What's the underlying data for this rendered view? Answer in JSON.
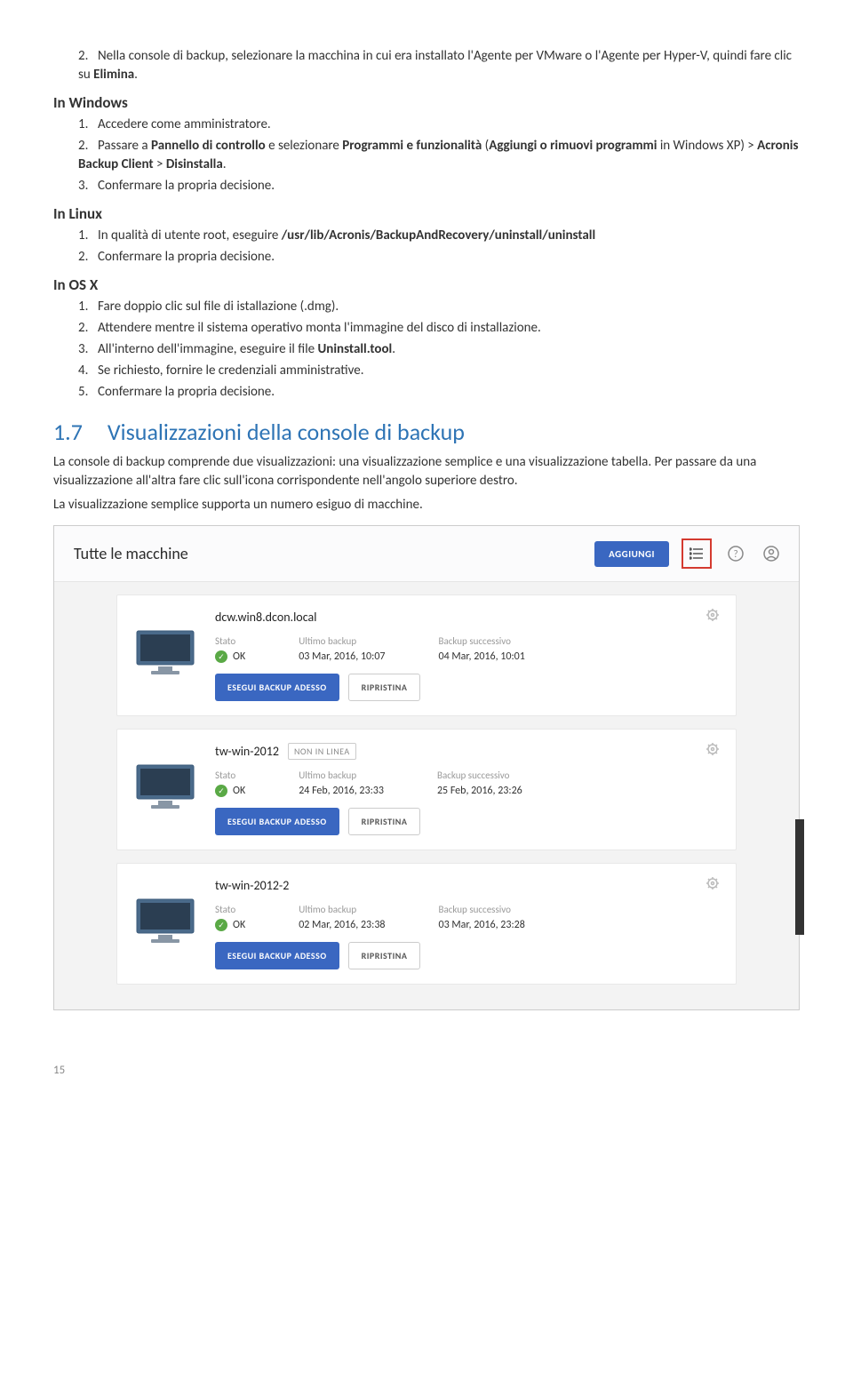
{
  "list1": {
    "i2": "Nella console di backup, selezionare la macchina in cui era installato l'Agente per VMware o l'Agente per Hyper-V, quindi fare clic su ",
    "i2b": "Elimina",
    "i2end": "."
  },
  "h_windows": "In Windows",
  "win": {
    "i1": "Accedere come amministratore.",
    "i2a": "Passare a ",
    "i2b": "Pannello di controllo",
    "i2c": " e selezionare ",
    "i2d": "Programmi e funzionalità",
    "i2e": " (",
    "i2f": "Aggiungi o rimuovi programmi",
    "i2g": " in Windows XP) > ",
    "i2h": "Acronis Backup Client",
    "i2i": " > ",
    "i2j": "Disinstalla",
    "i2k": ".",
    "i3": "Confermare la propria decisione."
  },
  "h_linux": "In Linux",
  "lin": {
    "i1a": "In qualità di utente root, eseguire ",
    "i1b": "/usr/lib/Acronis/BackupAndRecovery/uninstall/uninstall",
    "i2": "Confermare la propria decisione."
  },
  "h_osx": "In OS X",
  "osx": {
    "i1": "Fare doppio clic sul file di istallazione (.dmg).",
    "i2": "Attendere mentre il sistema operativo monta l'immagine del disco di installazione.",
    "i3a": "All'interno dell'immagine, eseguire il file ",
    "i3b": "Uninstall.tool",
    "i3c": ".",
    "i4": "Se richiesto, fornire le credenziali amministrative.",
    "i5": "Confermare la propria decisione."
  },
  "sec": {
    "num": "1.7",
    "title": "Visualizzazioni della console di backup"
  },
  "p1": "La console di backup comprende due visualizzazioni: una visualizzazione semplice e una visualizzazione tabella. Per passare da una visualizzazione all'altra fare clic sull'icona corrispondente nell'angolo superiore destro.",
  "p2": "La visualizzazione semplice supporta un numero esiguo di macchine.",
  "ui": {
    "title": "Tutte le macchine",
    "add": "AGGIUNGI",
    "col_state": "Stato",
    "col_last": "Ultimo backup",
    "col_next": "Backup successivo",
    "ok": "OK",
    "btn_backup": "ESEGUI BACKUP ADESSO",
    "btn_restore": "RIPRISTINA",
    "offline": "NON IN LINEA",
    "machines": [
      {
        "name": "dcw.win8.dcon.local",
        "offline": false,
        "last": "03 Mar, 2016, 10:07",
        "next": "04 Mar, 2016, 10:01"
      },
      {
        "name": "tw-win-2012",
        "offline": true,
        "last": "24 Feb, 2016, 23:33",
        "next": "25 Feb, 2016, 23:26"
      },
      {
        "name": "tw-win-2012-2",
        "offline": false,
        "last": "02 Mar, 2016, 23:38",
        "next": "03 Mar, 2016, 23:28"
      }
    ]
  },
  "page": "15"
}
